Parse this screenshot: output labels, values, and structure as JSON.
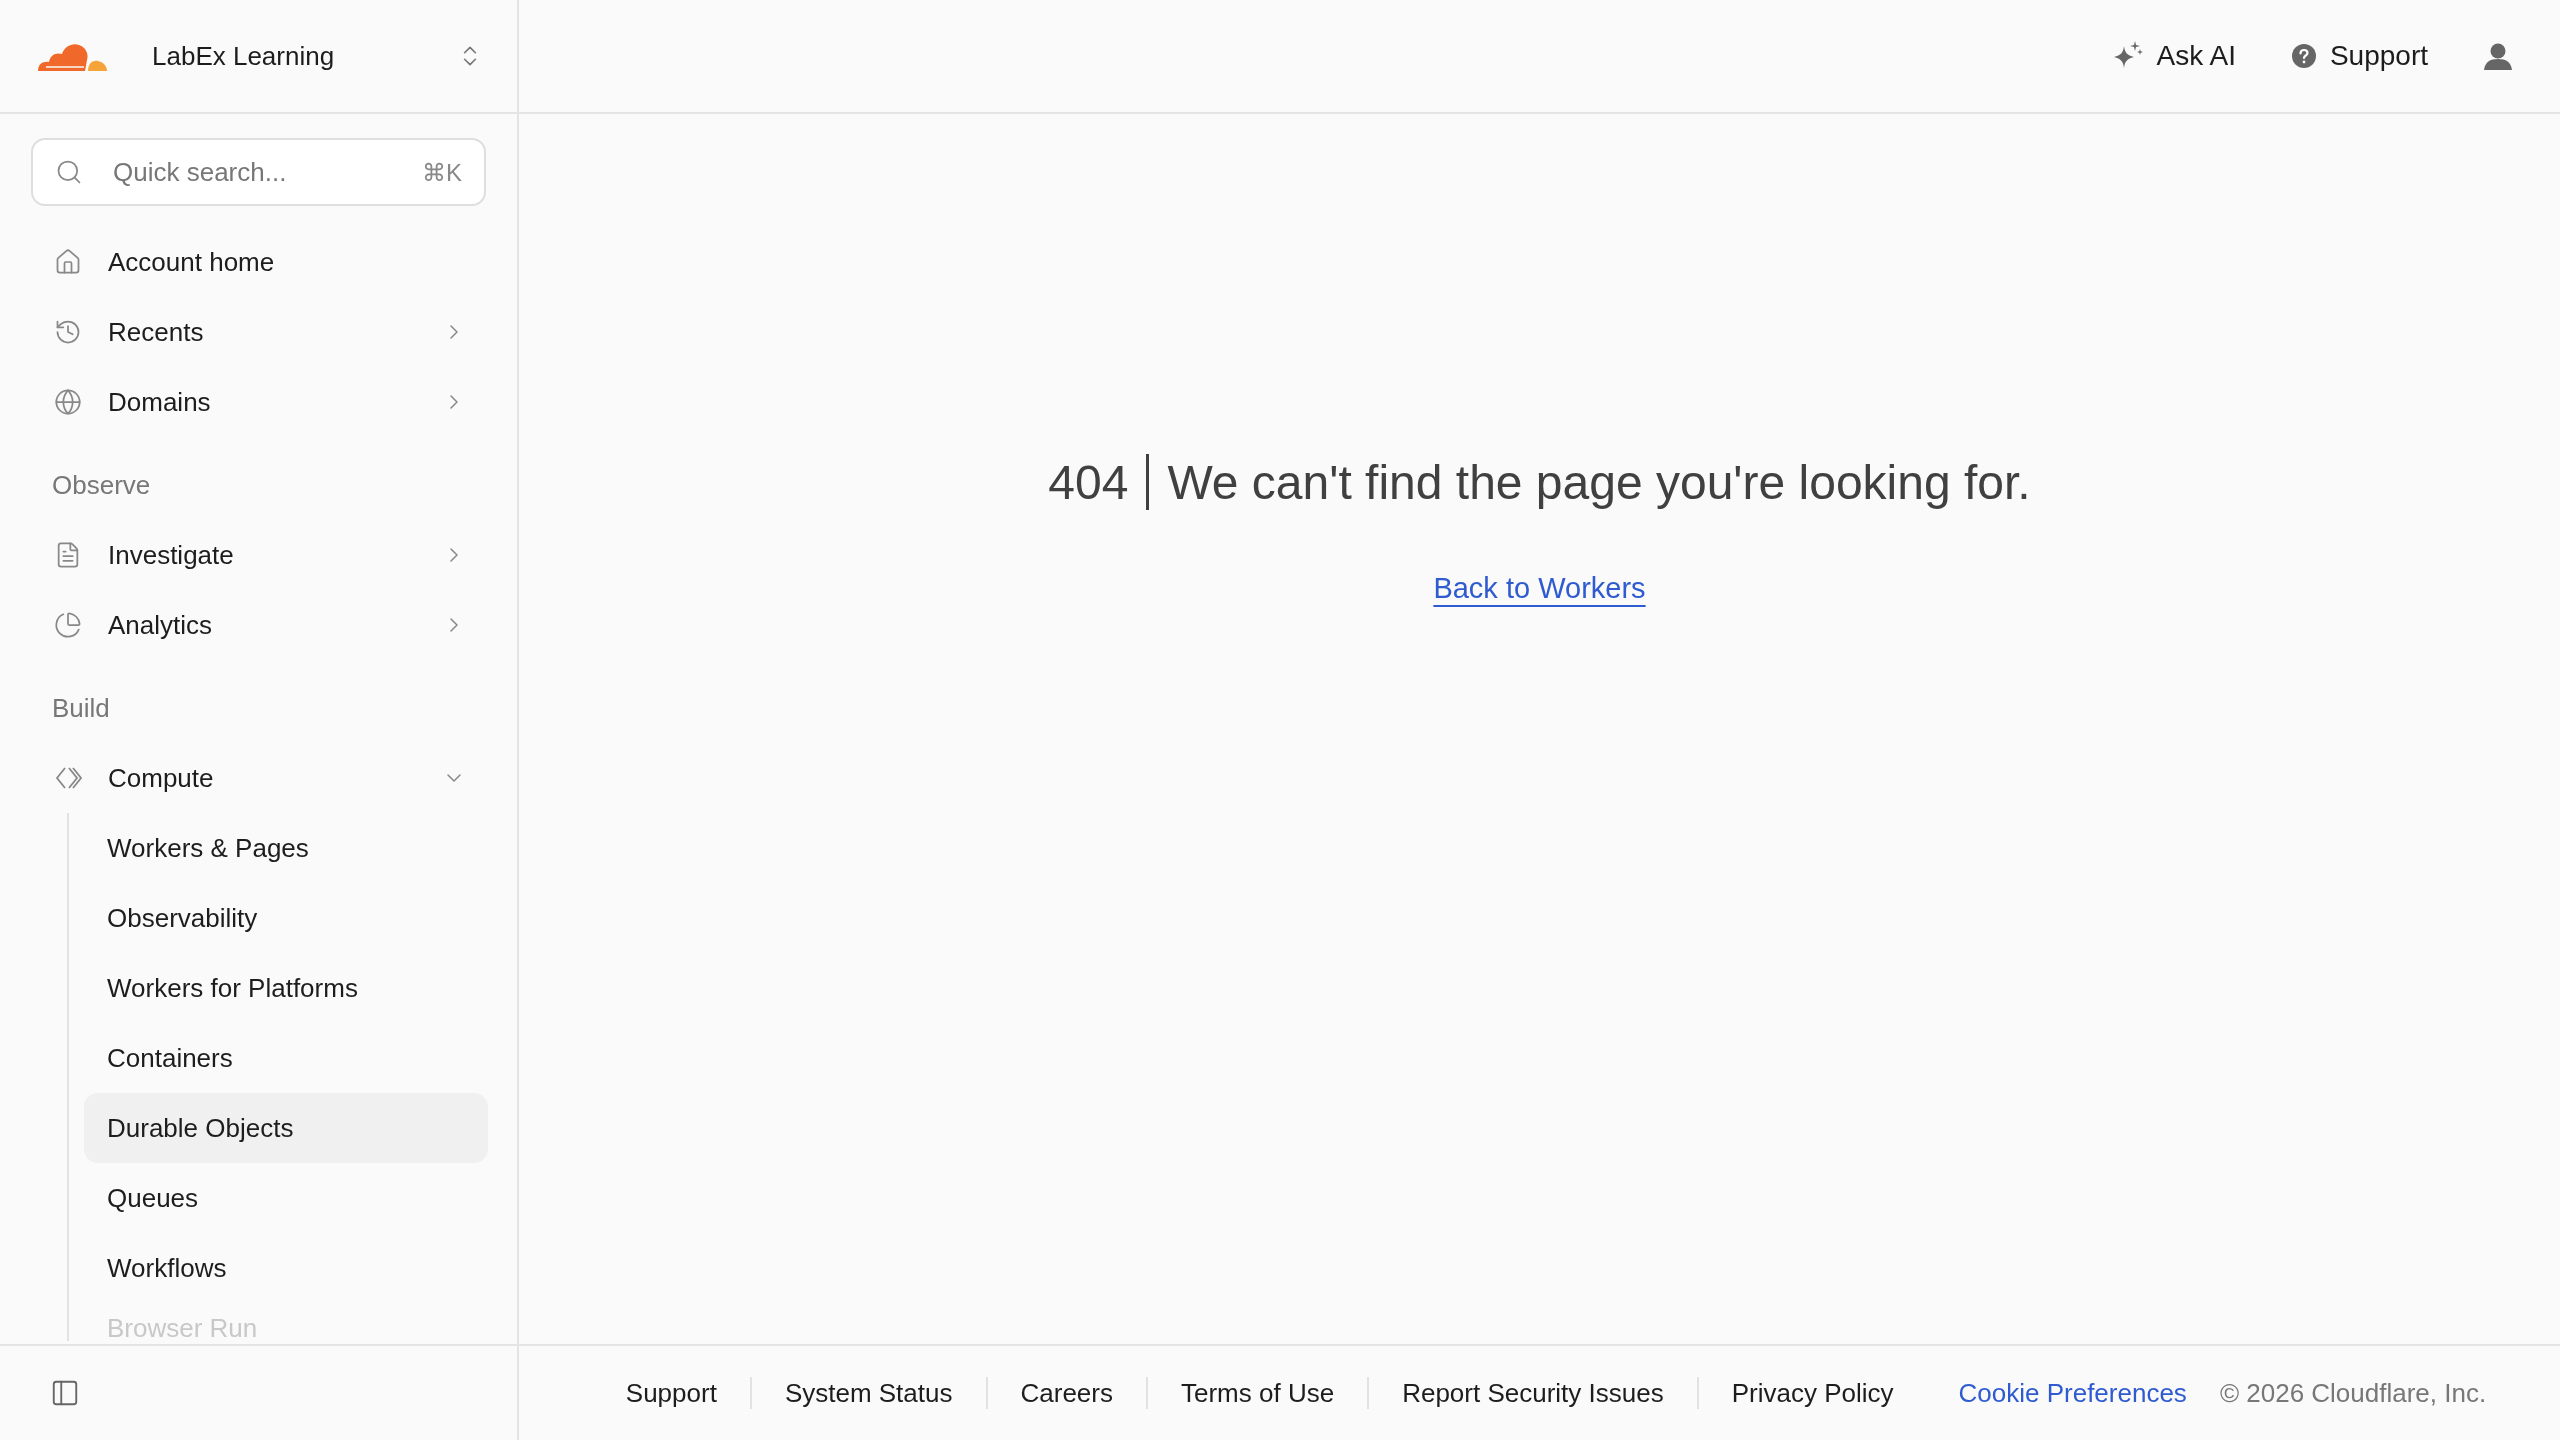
{
  "workspace": {
    "name": "LabEx Learning"
  },
  "search": {
    "placeholder": "Quick search...",
    "shortcut": "⌘K"
  },
  "sidebar": {
    "items": [
      {
        "kind": "link",
        "label": "Account home"
      },
      {
        "kind": "menu",
        "label": "Recents",
        "expanded": false
      },
      {
        "kind": "menu",
        "label": "Domains",
        "expanded": false
      },
      {
        "kind": "heading",
        "label": "Observe"
      },
      {
        "kind": "menu",
        "label": "Investigate",
        "expanded": false
      },
      {
        "kind": "menu",
        "label": "Analytics",
        "expanded": false
      },
      {
        "kind": "heading",
        "label": "Build"
      },
      {
        "kind": "menu",
        "label": "Compute",
        "expanded": true,
        "children": [
          {
            "label": "Workers & Pages",
            "selected": false
          },
          {
            "label": "Observability",
            "selected": false
          },
          {
            "label": "Workers for Platforms",
            "selected": false
          },
          {
            "label": "Containers",
            "selected": false
          },
          {
            "label": "Durable Objects",
            "selected": true
          },
          {
            "label": "Queues",
            "selected": false
          },
          {
            "label": "Workflows",
            "selected": false
          },
          {
            "label": "Browser Run",
            "selected": false
          }
        ]
      }
    ]
  },
  "header": {
    "actions": [
      {
        "kind": "ai",
        "label": "Ask AI"
      },
      {
        "kind": "help",
        "label": "Support"
      },
      {
        "kind": "account"
      }
    ]
  },
  "error": {
    "code": "404",
    "message": "We can't find the page you're looking for.",
    "link": "Back to Workers"
  },
  "footer": {
    "items": [
      {
        "kind": "link",
        "label": "Support"
      },
      {
        "kind": "link",
        "label": "System Status"
      },
      {
        "kind": "link",
        "label": "Careers"
      },
      {
        "kind": "link",
        "label": "Terms of Use"
      },
      {
        "kind": "link",
        "label": "Report Security Issues"
      },
      {
        "kind": "link",
        "label": "Privacy Policy"
      },
      {
        "kind": "preference",
        "label": "Cookie Preferences"
      },
      {
        "kind": "copyright",
        "label": "© 2026 Cloudflare, Inc."
      }
    ]
  }
}
